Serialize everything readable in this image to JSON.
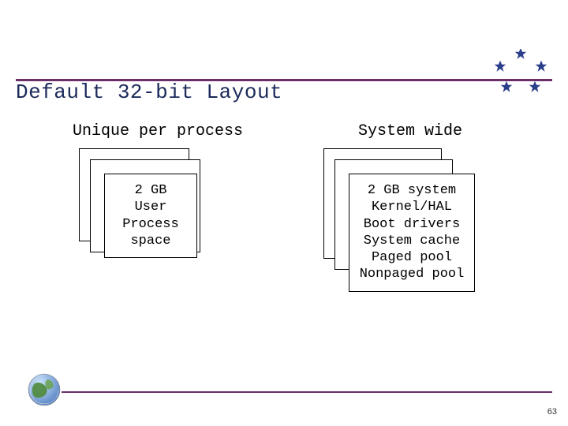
{
  "title": "Default 32-bit Layout",
  "left": {
    "heading": "Unique per process",
    "lines": [
      "2 GB",
      "User",
      "Process",
      "space"
    ]
  },
  "right": {
    "heading": "System wide",
    "lines": [
      "2 GB system",
      "Kernel/HAL",
      "Boot drivers",
      "System cache",
      "Paged pool",
      "Nonpaged pool"
    ]
  },
  "page_number": "63",
  "colors": {
    "accent": "#6a2e6a",
    "title": "#1b2a5a",
    "star": "#2b3e8a"
  }
}
